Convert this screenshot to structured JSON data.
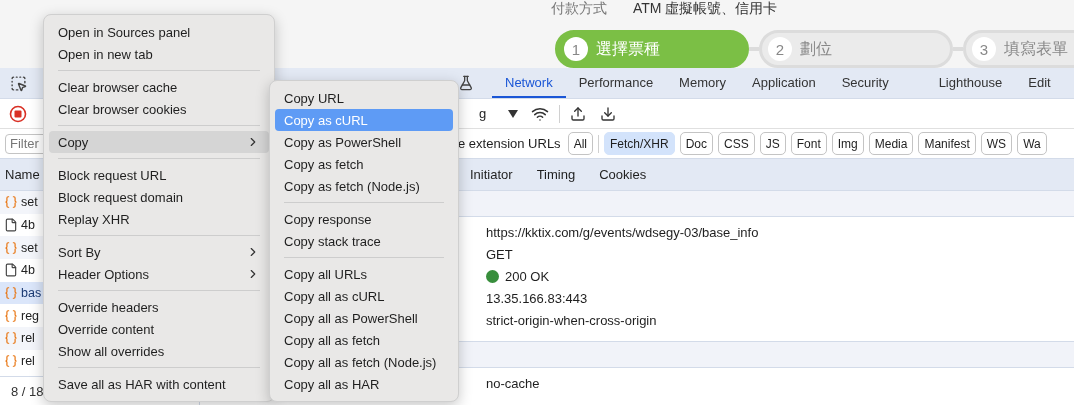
{
  "page": {
    "payment_label": "付款方式",
    "payment_value": "ATM 虛擬帳號、信用卡",
    "steps": [
      {
        "number": "1",
        "label": "選擇票種",
        "selected": true
      },
      {
        "number": "2",
        "label": "劃位",
        "selected": false
      },
      {
        "number": "3",
        "label": "填寫表單",
        "selected": false
      }
    ]
  },
  "devtools": {
    "tabs": [
      {
        "label": "Network",
        "selected": true
      },
      {
        "label": "Performance",
        "selected": false
      },
      {
        "label": "Memory",
        "selected": false
      },
      {
        "label": "Application",
        "selected": false
      },
      {
        "label": "Security",
        "selected": false
      },
      {
        "label": "Lighthouse",
        "selected": false
      },
      {
        "label": "Edit",
        "selected": false
      }
    ],
    "throttling": "g",
    "filter": {
      "placeholder": "Filter"
    },
    "extension_label": "e extension URLs",
    "type_filters": [
      {
        "label": "All",
        "selected": false
      },
      {
        "label": "Fetch/XHR",
        "selected": true
      },
      {
        "label": "Doc",
        "selected": false
      },
      {
        "label": "CSS",
        "selected": false
      },
      {
        "label": "JS",
        "selected": false
      },
      {
        "label": "Font",
        "selected": false
      },
      {
        "label": "Img",
        "selected": false
      },
      {
        "label": "Media",
        "selected": false
      },
      {
        "label": "Manifest",
        "selected": false
      },
      {
        "label": "WS",
        "selected": false
      },
      {
        "label": "Wa",
        "selected": false
      }
    ],
    "list_header": "Name",
    "requests": [
      {
        "name": "set",
        "kind": "fetch",
        "selected": false
      },
      {
        "name": "4b",
        "kind": "document",
        "selected": false
      },
      {
        "name": "set",
        "kind": "fetch",
        "selected": false
      },
      {
        "name": "4b",
        "kind": "document",
        "selected": false
      },
      {
        "name": "bas",
        "kind": "fetch",
        "selected": true
      },
      {
        "name": "reg",
        "kind": "fetch",
        "selected": false
      },
      {
        "name": "rel",
        "kind": "fetch",
        "selected": false
      },
      {
        "name": "rel",
        "kind": "fetch",
        "selected": false
      }
    ],
    "footer": "8 / 18",
    "detail_tabs": [
      "Initiator",
      "Timing",
      "Cookies"
    ],
    "general_values": [
      {
        "value": "https://kktix.com/g/events/wdsegy-03/base_info",
        "kind": "text"
      },
      {
        "value": "GET",
        "kind": "text"
      },
      {
        "value": "200 OK",
        "kind": "status"
      },
      {
        "value": "13.35.166.83:443",
        "kind": "text"
      },
      {
        "value": "strict-origin-when-cross-origin",
        "kind": "text"
      }
    ],
    "response_values": [
      "no-cache"
    ]
  },
  "context_menu": {
    "groups": [
      [
        {
          "label": "Open in Sources panel",
          "submenu": false,
          "selected": false
        },
        {
          "label": "Open in new tab",
          "submenu": false,
          "selected": false
        }
      ],
      [
        {
          "label": "Clear browser cache",
          "submenu": false,
          "selected": false
        },
        {
          "label": "Clear browser cookies",
          "submenu": false,
          "selected": false
        }
      ],
      [
        {
          "label": "Copy",
          "submenu": true,
          "selected": true
        }
      ],
      [
        {
          "label": "Block request URL",
          "submenu": false,
          "selected": false
        },
        {
          "label": "Block request domain",
          "submenu": false,
          "selected": false
        },
        {
          "label": "Replay XHR",
          "submenu": false,
          "selected": false
        }
      ],
      [
        {
          "label": "Sort By",
          "submenu": true,
          "selected": false
        },
        {
          "label": "Header Options",
          "submenu": true,
          "selected": false
        }
      ],
      [
        {
          "label": "Override headers",
          "submenu": false,
          "selected": false
        },
        {
          "label": "Override content",
          "submenu": false,
          "selected": false
        },
        {
          "label": "Show all overrides",
          "submenu": false,
          "selected": false
        }
      ],
      [
        {
          "label": "Save all as HAR with content",
          "submenu": false,
          "selected": false
        }
      ]
    ]
  },
  "copy_submenu": {
    "groups": [
      [
        {
          "label": "Copy URL",
          "selected": false
        },
        {
          "label": "Copy as cURL",
          "selected": true
        },
        {
          "label": "Copy as PowerShell",
          "selected": false
        },
        {
          "label": "Copy as fetch",
          "selected": false
        },
        {
          "label": "Copy as fetch (Node.js)",
          "selected": false
        }
      ],
      [
        {
          "label": "Copy response",
          "selected": false
        },
        {
          "label": "Copy stack trace",
          "selected": false
        }
      ],
      [
        {
          "label": "Copy all URLs",
          "selected": false
        },
        {
          "label": "Copy all as cURL",
          "selected": false
        },
        {
          "label": "Copy all as PowerShell",
          "selected": false
        },
        {
          "label": "Copy all as fetch",
          "selected": false
        },
        {
          "label": "Copy all as fetch (Node.js)",
          "selected": false
        },
        {
          "label": "Copy all as HAR",
          "selected": false
        }
      ]
    ]
  }
}
